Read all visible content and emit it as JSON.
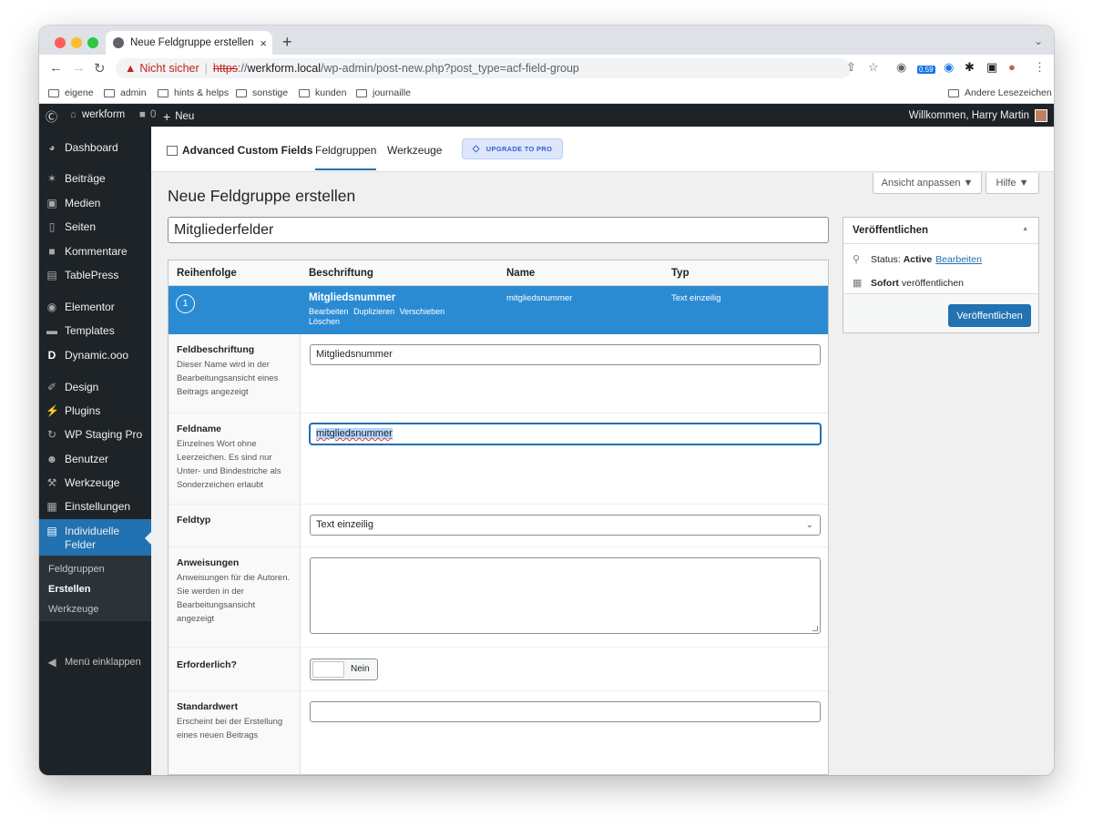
{
  "browser": {
    "tab_title": "Neue Feldgruppe erstellen ‹ w",
    "tab_close": "×",
    "new_tab": "+",
    "warning_label": "Nicht sicher",
    "url_scheme": "https",
    "url_scheme_sep": "://",
    "url_host": "werkform.local",
    "url_path": "/wp-admin/post-new.php?post_type=acf-field-group",
    "extension_badge": "0.59",
    "bookmarks": [
      "eigene",
      "admin",
      "hints & helps",
      "sonstige",
      "kunden",
      "journaille"
    ],
    "other_bookmarks": "Andere Lesezeichen"
  },
  "adminbar": {
    "site_name": "werkform",
    "comments_count": "0",
    "new_label": "Neu",
    "greeting": "Willkommen, Harry Martin"
  },
  "sidebar": {
    "items": [
      {
        "label": "Dashboard",
        "icon": "dashboard-icon"
      },
      {
        "label": "Beiträge",
        "icon": "pin-icon"
      },
      {
        "label": "Medien",
        "icon": "media-icon"
      },
      {
        "label": "Seiten",
        "icon": "page-icon"
      },
      {
        "label": "Kommentare",
        "icon": "comment-icon"
      },
      {
        "label": "TablePress",
        "icon": "table-icon"
      },
      {
        "label": "Elementor",
        "icon": "elementor-icon"
      },
      {
        "label": "Templates",
        "icon": "folder-icon"
      },
      {
        "label": "Dynamic.ooo",
        "icon": "dynamic-icon"
      },
      {
        "label": "Design",
        "icon": "brush-icon"
      },
      {
        "label": "Plugins",
        "icon": "plugin-icon"
      },
      {
        "label": "WP Staging Pro",
        "icon": "sync-icon"
      },
      {
        "label": "Benutzer",
        "icon": "user-icon"
      },
      {
        "label": "Werkzeuge",
        "icon": "wrench-icon"
      },
      {
        "label": "Einstellungen",
        "icon": "settings-icon"
      }
    ],
    "active_line1": "Individuelle",
    "active_line2": "Felder",
    "submenu": [
      "Feldgruppen",
      "Erstellen",
      "Werkzeuge"
    ],
    "collapse_label": "Menü einklappen"
  },
  "acf_header": {
    "logo_text": "Advanced Custom Fields",
    "tabs": [
      "Feldgruppen",
      "Werkzeuge"
    ],
    "upgrade_label": "UPGRADE TO PRO"
  },
  "screen_options": {
    "view_label": "Ansicht anpassen ▼",
    "help_label": "Hilfe ▼"
  },
  "page": {
    "title": "Neue Feldgruppe erstellen",
    "group_title_value": "Mitgliederfelder"
  },
  "publish_box": {
    "heading": "Veröffentlichen",
    "status_prefix": "Status: ",
    "status_value": "Active",
    "edit_link": "Bearbeiten",
    "schedule_bold": "Sofort",
    "schedule_rest": " veröffentlichen",
    "button_label": "Veröffentlichen"
  },
  "field_table": {
    "headers": [
      "Reihenfolge",
      "Beschriftung",
      "Name",
      "Typ"
    ],
    "row": {
      "order": "1",
      "label": "Mitgliedsnummer",
      "actions": [
        "Bearbeiten",
        "Duplizieren",
        "Verschieben",
        "Löschen"
      ],
      "name": "mitgliedsnummer",
      "type": "Text einzeilig"
    }
  },
  "field_settings": {
    "label": {
      "title": "Feldbeschriftung",
      "description": "Dieser Name wird in der Bearbeitungsansicht eines Beitrags angezeigt",
      "value": "Mitgliedsnummer"
    },
    "name": {
      "title": "Feldname",
      "description": "Einzelnes Wort ohne Leerzeichen. Es sind nur Unter- und Bindestriche als Sonderzeichen erlaubt",
      "value": "mitgliedsnummer"
    },
    "type": {
      "title": "Feldtyp",
      "value": "Text einzeilig"
    },
    "instructions": {
      "title": "Anweisungen",
      "description": "Anweisungen für die Autoren. Sie werden in der Bearbeitungsansicht angezeigt",
      "value": ""
    },
    "required": {
      "title": "Erforderlich?",
      "toggle_label": "Nein"
    },
    "default": {
      "title": "Standardwert",
      "description": "Erscheint bei der Erstellung eines neuen Beitrags",
      "value": ""
    }
  }
}
